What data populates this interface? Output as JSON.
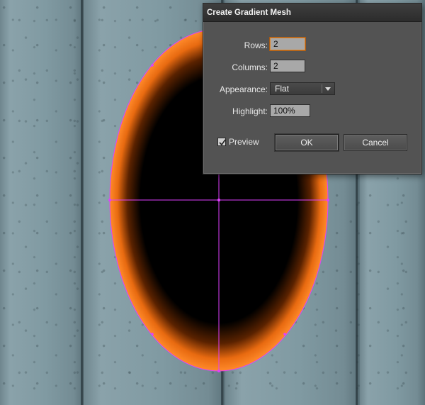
{
  "dialog": {
    "title": "Create Gradient Mesh",
    "rows_label": "Rows:",
    "rows_value": "2",
    "columns_label": "Columns:",
    "columns_value": "2",
    "appearance_label": "Appearance:",
    "appearance_value": "Flat",
    "highlight_label": "Highlight:",
    "highlight_value": "100%",
    "preview_label": "Preview",
    "preview_checked": true,
    "ok_label": "OK",
    "cancel_label": "Cancel"
  },
  "colors": {
    "mesh_center": "#000000",
    "mesh_edge": "#ff7a1a",
    "mesh_lines": "#e040ff",
    "dialog_bg": "#535353",
    "focus_ring": "#e0882c"
  }
}
